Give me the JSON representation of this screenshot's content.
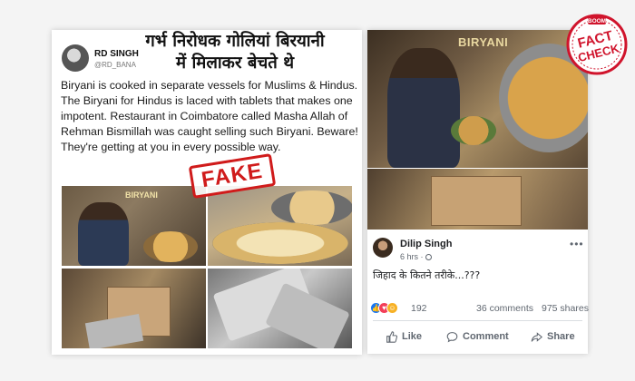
{
  "headline": {
    "line1": "गर्भ निरोधक गोलियां बिरयानी",
    "line2": "में मिलाकर बेचते थे"
  },
  "tweet": {
    "name": "RD SINGH",
    "handle": "@RD_BANA",
    "text": "Biryani is cooked in separate vessels for Muslims & Hindus. The Biryani for Hindus is laced with tablets that makes one impotent. Restaurant in Coimbatore called Masha Allah of Rehman Bismillah was caught selling such Biryani. Beware! They're getting at you in every possible way.",
    "image_label": "BIRYANI",
    "stamp": "FAKE"
  },
  "facebook_post": {
    "photo_label": "BIRYANI",
    "author": "Dilip Singh",
    "time": "6 hrs",
    "text": "जिहाद के कितने तरीके...???",
    "reaction_count": "192",
    "comments": "36 comments",
    "shares": "975 shares",
    "actions": {
      "like": "Like",
      "comment": "Comment",
      "share": "Share"
    },
    "colors": {
      "like_blue": "#1877f2",
      "love_red": "#f33e58",
      "haha_yellow": "#f7b125"
    }
  },
  "seal": {
    "top_text": "BOOM",
    "line1": "FACT",
    "line2": "CHECK",
    "color": "#d0142c"
  }
}
